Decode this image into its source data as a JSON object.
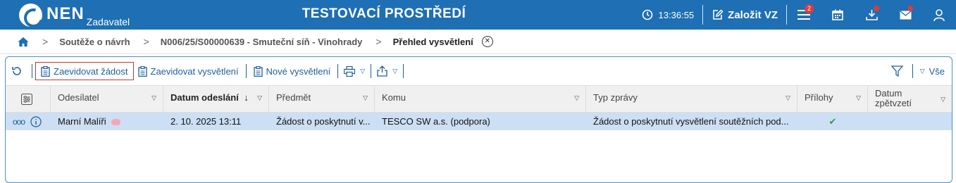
{
  "app": {
    "logo_text": "NEN",
    "logo_sub": "Zadavatel",
    "environment": "TESTOVACÍ PROSTŘEDÍ",
    "clock": "13:36:55",
    "create_label": "Založit VZ",
    "menu_badge": "2",
    "brand_color": "#1e6fb3"
  },
  "breadcrumb": {
    "items": [
      "Soutěže o návrh",
      "N006/25/S00000639 - Smuteční síň - Vinohrady"
    ],
    "current": "Přehled vysvětlení"
  },
  "toolbar": {
    "btn1": "Zaevidovat žádost",
    "btn2": "Zaevidovat vysvětlení",
    "btn3": "Nové vysvětlení",
    "filter_all": "Vše"
  },
  "table": {
    "columns": [
      "Odesílatel",
      "Datum odeslání",
      "Předmět",
      "Komu",
      "Typ zprávy",
      "Přílohy",
      "Datum zpětvzetí"
    ],
    "rows": [
      {
        "sender": "Marní Malíři",
        "date": "2. 10. 2025 13:11",
        "subject": "Žádost o poskytnutí v...",
        "to": "TESCO SW a.s. (podpora)",
        "type": "Žádost o poskytnutí vysvětlení soutěžních pod...",
        "attachments": "✔",
        "withdrawn": ""
      }
    ]
  }
}
